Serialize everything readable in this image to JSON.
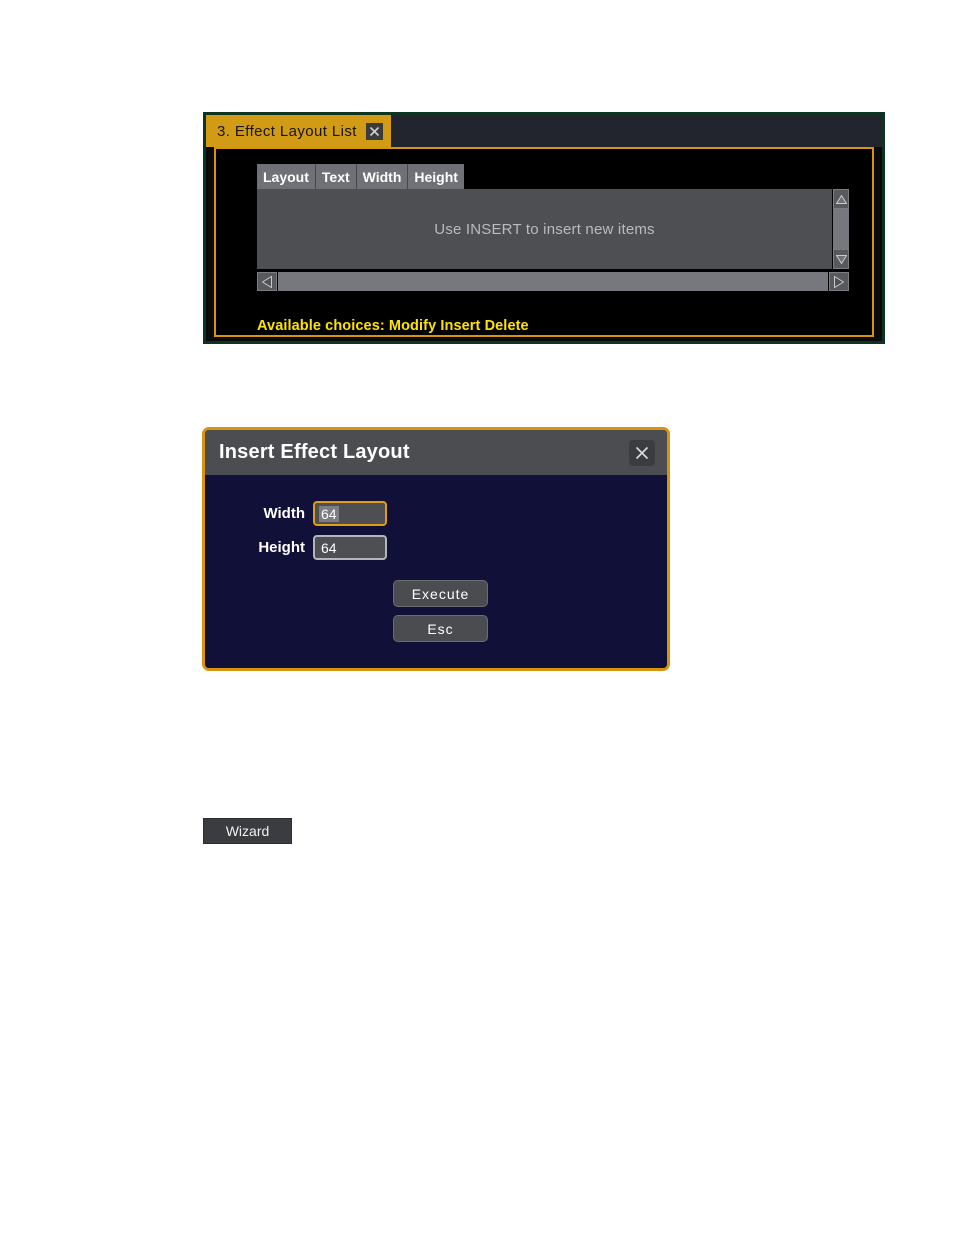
{
  "effect_layout_panel": {
    "tab_title": "3. Effect Layout List",
    "close_icon": "close-icon",
    "columns": [
      "Layout",
      "Text",
      "Width",
      "Height"
    ],
    "empty_message": "Use INSERT to insert new items",
    "status_text": "Available choices: Modify Insert Delete",
    "scrollbars": {
      "vertical_up_icon": "triangle-up-icon",
      "vertical_down_icon": "triangle-down-icon",
      "horizontal_left_icon": "triangle-left-icon",
      "horizontal_right_icon": "triangle-right-icon"
    },
    "colors": {
      "tab_background": "#d29b16",
      "frame_border": "#d8930f",
      "outer_border": "#0d3321",
      "status_text": "#ffe400",
      "titlebar_background": "#22252e"
    }
  },
  "insert_dialog": {
    "title": "Insert Effect Layout",
    "close_icon": "close-icon",
    "fields": [
      {
        "label": "Width",
        "value": "64",
        "focused": true
      },
      {
        "label": "Height",
        "value": "64",
        "focused": false
      }
    ],
    "buttons": [
      {
        "label": "Execute"
      },
      {
        "label": "Esc"
      }
    ],
    "colors": {
      "body_background": "#101038",
      "border": "#d8930f",
      "titlebar_background": "#4b4d51",
      "focus_border": "#e09c12"
    }
  },
  "wizard_button": {
    "label": "Wizard"
  }
}
